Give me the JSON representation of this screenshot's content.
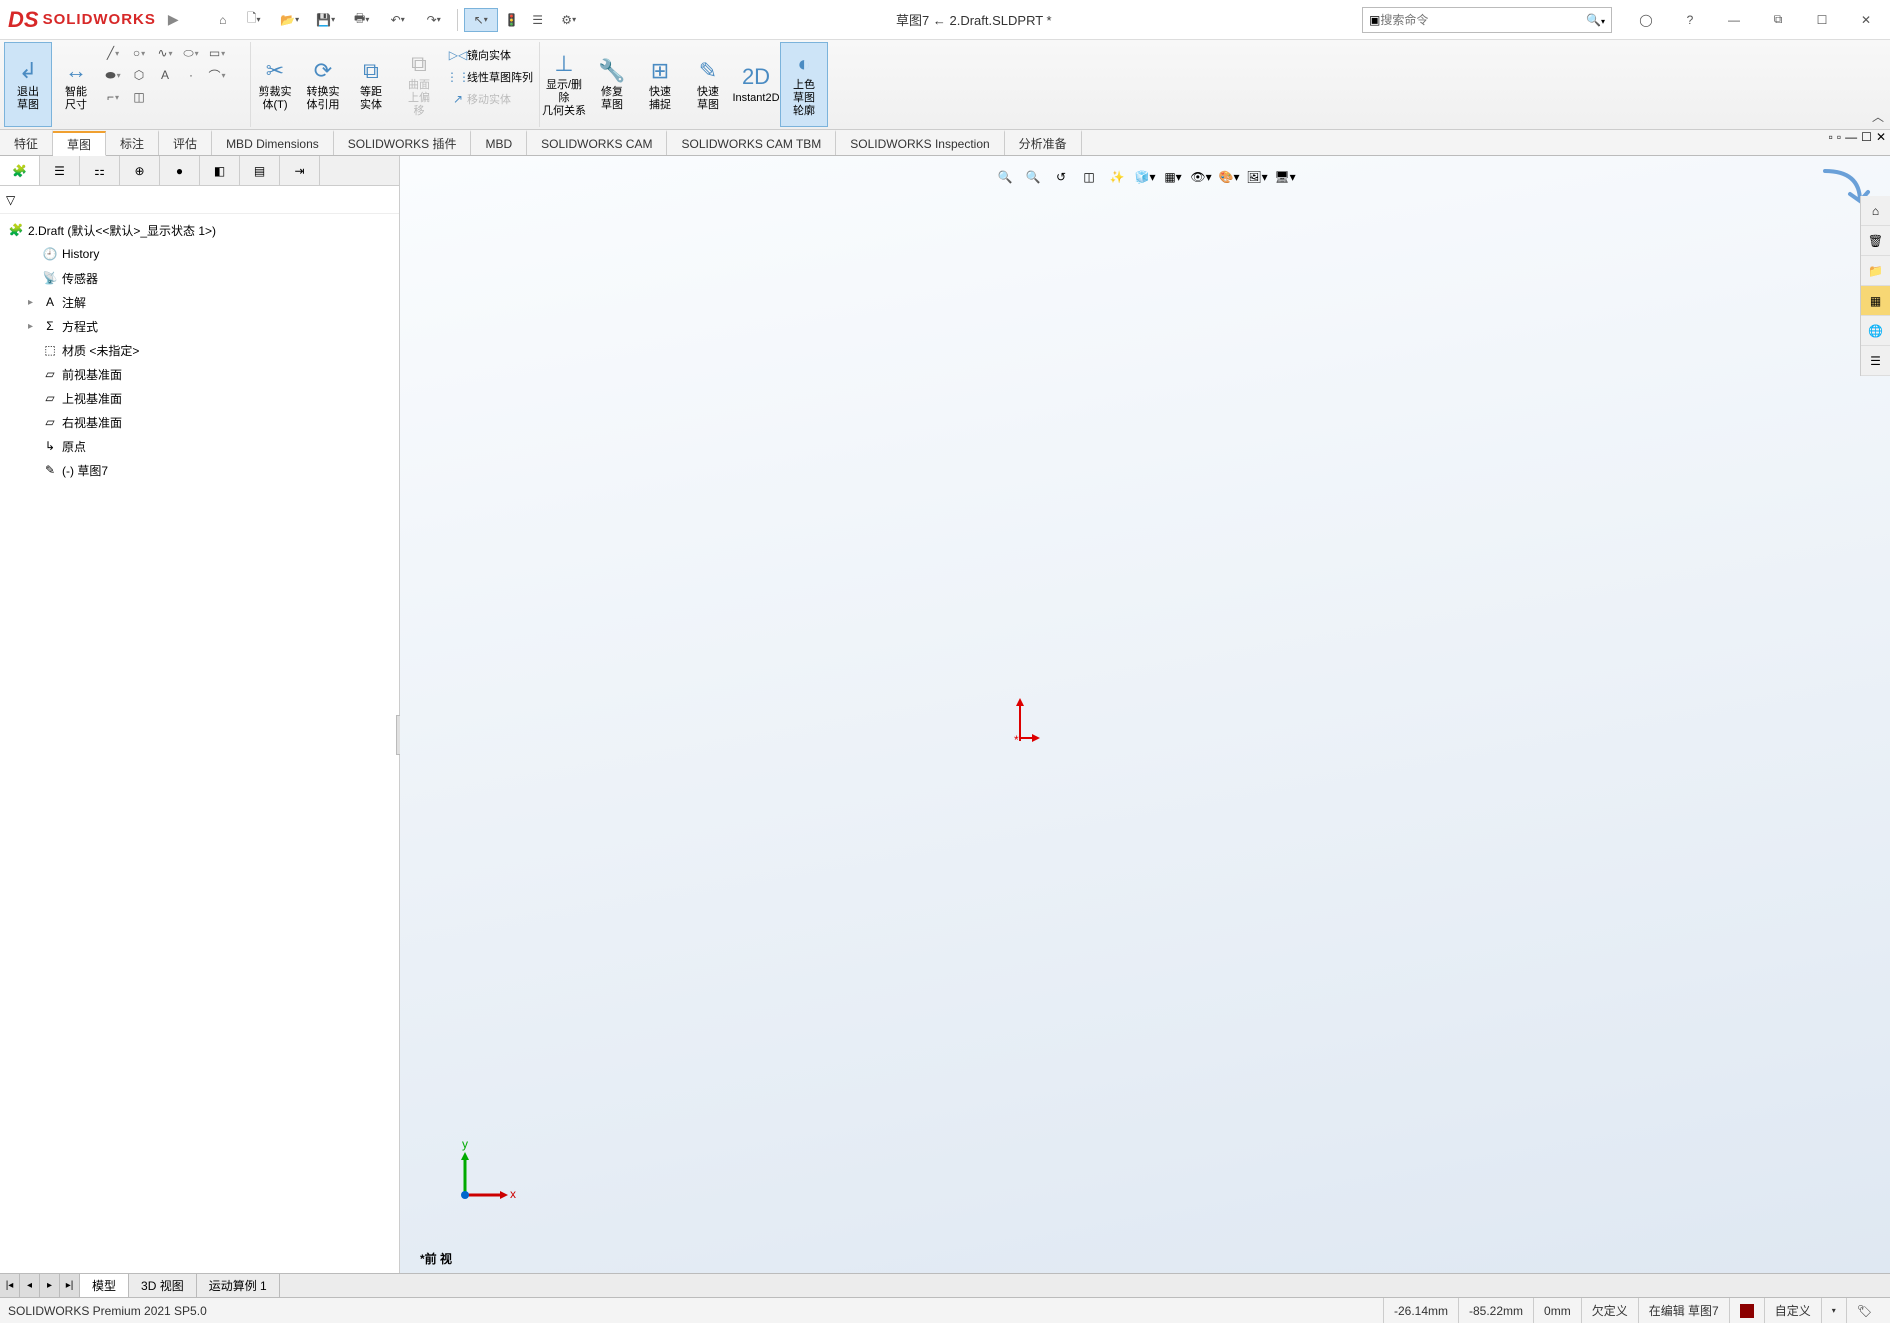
{
  "app": {
    "logo_text": "SOLIDWORKS",
    "doc_title": "草图7 ← 2.Draft.SLDPRT *",
    "search_placeholder": "搜索命令"
  },
  "ribbon": {
    "exit_sketch": "退出\n草图",
    "smart_dim": "智能\n尺寸",
    "trim": "剪裁实\n体(T)",
    "convert": "转换实\n体引用",
    "offset": "等距\n实体",
    "surface_offset": "曲面\n上偏\n移",
    "mirror": "镜向实体",
    "linear_pattern": "线性草图阵列",
    "move": "移动实体",
    "display_rel": "显示/删除\n几何关系",
    "repair": "修复\n草图",
    "quick_snap": "快速\n捕捉",
    "rapid_sketch": "快速\n草图",
    "instant2d": "Instant2D",
    "shade": "上色\n草图\n轮廓"
  },
  "feature_tabs": [
    "特征",
    "草图",
    "标注",
    "评估",
    "MBD Dimensions",
    "SOLIDWORKS 插件",
    "MBD",
    "SOLIDWORKS CAM",
    "SOLIDWORKS CAM TBM",
    "SOLIDWORKS Inspection",
    "分析准备"
  ],
  "tree": {
    "root": "2.Draft  (默认<<默认>_显示状态 1>)",
    "items": [
      {
        "icon": "history",
        "label": "History"
      },
      {
        "icon": "sensor",
        "label": "传感器"
      },
      {
        "icon": "annot",
        "label": "注解",
        "exp": "▸"
      },
      {
        "icon": "eq",
        "label": "方程式",
        "exp": "▸"
      },
      {
        "icon": "mat",
        "label": "材质 <未指定>"
      },
      {
        "icon": "plane",
        "label": "前视基准面"
      },
      {
        "icon": "plane",
        "label": "上视基准面"
      },
      {
        "icon": "plane",
        "label": "右视基准面"
      },
      {
        "icon": "origin",
        "label": "原点"
      },
      {
        "icon": "sketch",
        "label": "(-) 草图7"
      }
    ]
  },
  "view_label": "*前 视",
  "bottom_tabs": [
    "模型",
    "3D 视图",
    "运动算例 1"
  ],
  "status": {
    "product": "SOLIDWORKS Premium 2021 SP5.0",
    "x": "-26.14mm",
    "y": "-85.22mm",
    "z": "0mm",
    "state": "欠定义",
    "edit": "在编辑 草图7",
    "units": "自定义"
  }
}
